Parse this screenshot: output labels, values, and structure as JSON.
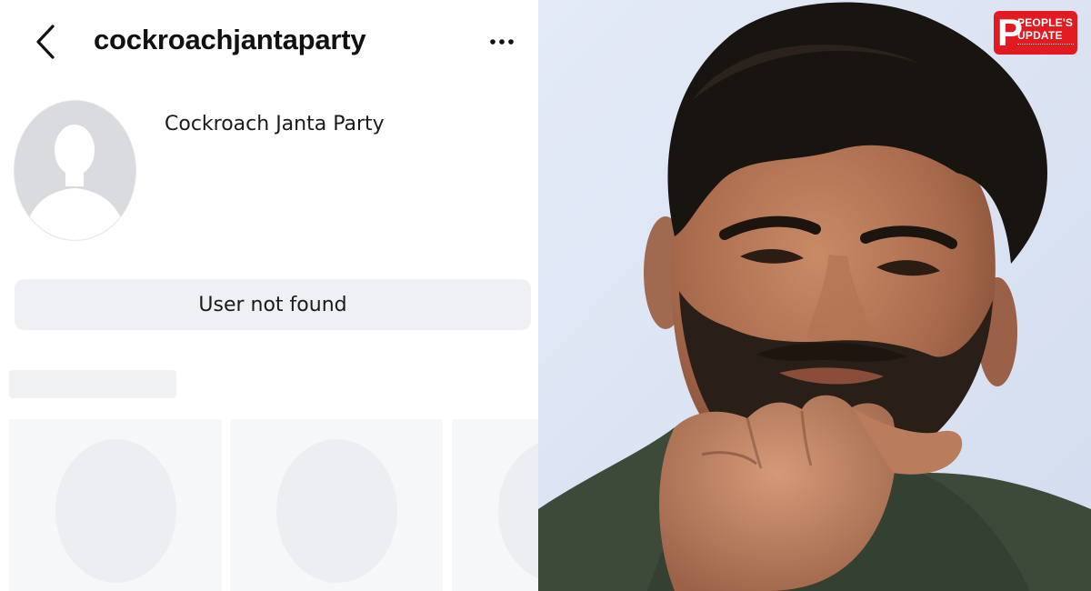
{
  "header": {
    "back_icon": "chevron-left-icon",
    "username": "cockroachjantaparty",
    "more_icon": "more-horizontal-icon"
  },
  "profile": {
    "display_name": "Cockroach Janta Party",
    "avatar_icon": "default-avatar-silhouette"
  },
  "status": {
    "label": "User not found"
  },
  "photo": {
    "description_icon": "man-thinking-photo"
  },
  "logo": {
    "letter": "P",
    "line1": "PEOPLE'S",
    "line2": "UPDATE",
    "colors": {
      "background": "#e21b23",
      "text": "#ffffff"
    }
  },
  "colors": {
    "background_left": "#ffffff",
    "text_primary": "#111111",
    "button_bg": "#eef0f3",
    "skeleton": "#f1f2f4",
    "photo_background": "#dfe6f5"
  }
}
